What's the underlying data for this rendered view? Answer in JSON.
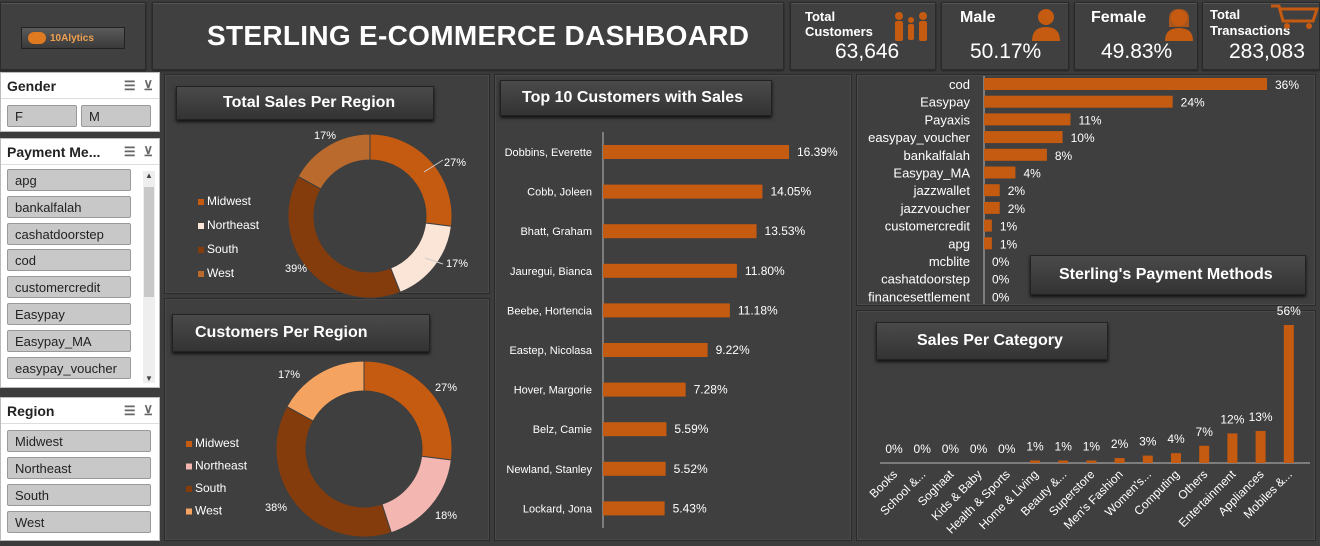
{
  "header": {
    "logo_text": "10Alytics",
    "logo_sub": "Data Technology",
    "title": "STERLING E-COMMERCE DASHBOARD"
  },
  "kpis": {
    "total_customers_label": "Total Customers",
    "total_customers_value": "63,646",
    "male_label": "Male",
    "male_value": "50.17%",
    "female_label": "Female",
    "female_value": "49.83%",
    "transactions_label": "Total Transactions",
    "transactions_value": "283,083"
  },
  "slicers": {
    "gender": {
      "title": "Gender",
      "items": [
        "F",
        "M"
      ]
    },
    "payment": {
      "title": "Payment Me...",
      "items": [
        "apg",
        "bankalfalah",
        "cashatdoorstep",
        "cod",
        "customercredit",
        "Easypay",
        "Easypay_MA",
        "easypay_voucher"
      ]
    },
    "region": {
      "title": "Region",
      "items": [
        "Midwest",
        "Northeast",
        "South",
        "West"
      ]
    }
  },
  "titles": {
    "sales_region": "Total Sales Per Region",
    "customers_region": "Customers Per Region",
    "top10": "Top 10 Customers with Sales",
    "payment": "Sterling's Payment Methods",
    "category": "Sales Per Category"
  },
  "colors": {
    "accent": "#c55a11",
    "dark": "#843c0c",
    "light": "#fbe5d6",
    "pink": "#f4b6b0",
    "peach": "#f4a460",
    "tan": "#b96a2c"
  },
  "chart_data": [
    {
      "type": "pie",
      "title": "Total Sales Per Region",
      "categories": [
        "Midwest",
        "Northeast",
        "South",
        "West"
      ],
      "values": [
        27,
        17,
        39,
        17
      ],
      "labels": [
        "27%",
        "17%",
        "39%",
        "17%"
      ]
    },
    {
      "type": "pie",
      "title": "Customers Per Region",
      "categories": [
        "Midwest",
        "Northeast",
        "South",
        "West"
      ],
      "values": [
        27,
        18,
        38,
        17
      ],
      "labels": [
        "27%",
        "18%",
        "38%",
        "17%"
      ]
    },
    {
      "type": "bar",
      "title": "Top 10 Customers with Sales",
      "categories": [
        "Dobbins, Everette",
        "Cobb, Joleen",
        "Bhatt, Graham",
        "Jauregui, Bianca",
        "Beebe, Hortencia",
        "Eastep, Nicolasa",
        "Hover, Margorie",
        "Belz, Camie",
        "Newland, Stanley",
        "Lockard, Jona"
      ],
      "values": [
        16.39,
        14.05,
        13.53,
        11.8,
        11.18,
        9.22,
        7.28,
        5.59,
        5.52,
        5.43
      ],
      "labels": [
        "16.39%",
        "14.05%",
        "13.53%",
        "11.80%",
        "11.18%",
        "9.22%",
        "7.28%",
        "5.59%",
        "5.52%",
        "5.43%"
      ]
    },
    {
      "type": "bar",
      "title": "Sterling's Payment Methods",
      "categories": [
        "cod",
        "Easypay",
        "Payaxis",
        "easypay_voucher",
        "bankalfalah",
        "Easypay_MA",
        "jazzwallet",
        "jazzvoucher",
        "customercredit",
        "apg",
        "mcblite",
        "cashatdoorstep",
        "financesettlement"
      ],
      "values": [
        36,
        24,
        11,
        10,
        8,
        4,
        2,
        2,
        1,
        1,
        0,
        0,
        0
      ],
      "labels": [
        "36%",
        "24%",
        "11%",
        "10%",
        "8%",
        "4%",
        "2%",
        "2%",
        "1%",
        "1%",
        "0%",
        "0%",
        "0%"
      ]
    },
    {
      "type": "bar",
      "title": "Sales Per Category",
      "categories": [
        "Books",
        "School &...",
        "Soghaat",
        "Kids & Baby",
        "Health & Sports",
        "Home & Living",
        "Beauty &...",
        "Superstore",
        "Men's Fashion",
        "Women's...",
        "Computing",
        "Others",
        "Entertainment",
        "Appliances",
        "Mobiles &..."
      ],
      "values": [
        0,
        0,
        0,
        0,
        0,
        1,
        1,
        1,
        2,
        3,
        4,
        7,
        12,
        13,
        56
      ],
      "labels": [
        "0%",
        "0%",
        "0%",
        "0%",
        "0%",
        "1%",
        "1%",
        "1%",
        "2%",
        "3%",
        "4%",
        "7%",
        "12%",
        "13%",
        "56%"
      ]
    }
  ]
}
